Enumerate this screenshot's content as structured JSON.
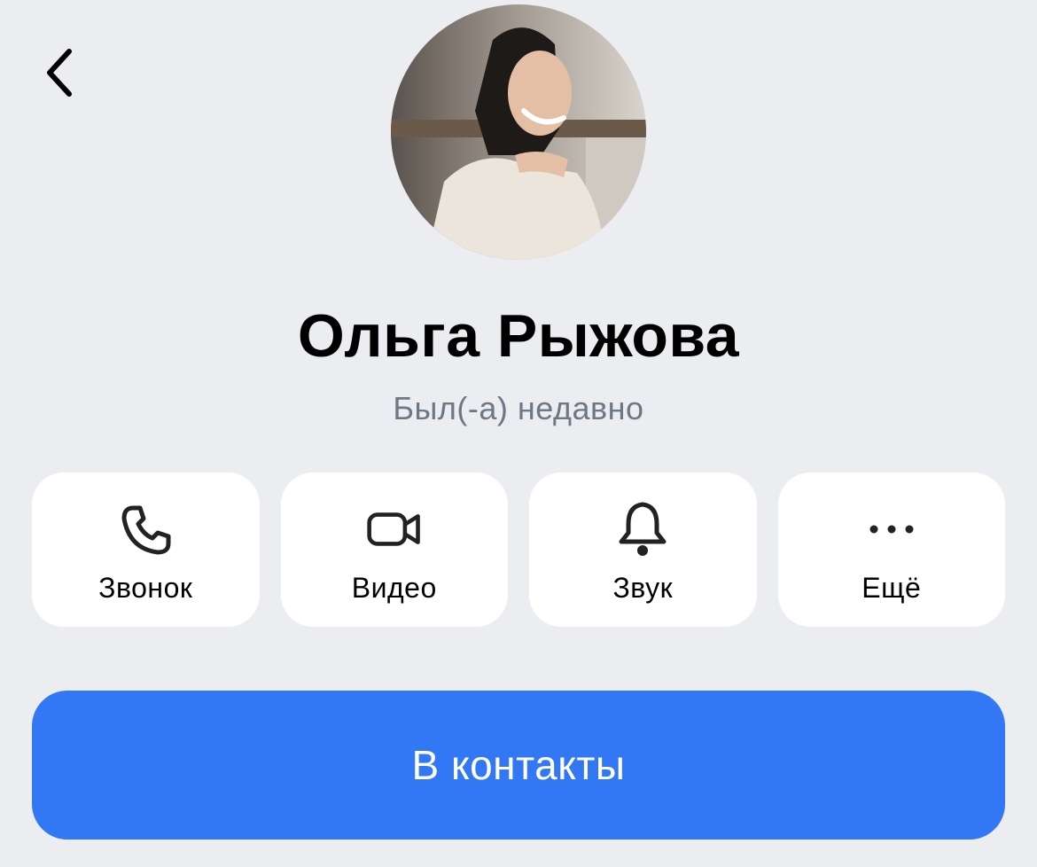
{
  "header": {
    "back_icon": "chevron-left-icon"
  },
  "profile": {
    "name": "Ольга Рыжова",
    "status": "Был(-а) недавно",
    "avatar_alt": "profile photo"
  },
  "actions": [
    {
      "label": "Звонок",
      "icon": "phone-icon"
    },
    {
      "label": "Видео",
      "icon": "video-camera-icon"
    },
    {
      "label": "Звук",
      "icon": "bell-icon"
    },
    {
      "label": "Ещё",
      "icon": "more-dots-icon"
    }
  ],
  "primary_button": {
    "label": "В контакты"
  },
  "colors": {
    "background": "#ebedf0",
    "card": "#ffffff",
    "accent": "#3277f3",
    "secondary_text": "#6d7885"
  }
}
